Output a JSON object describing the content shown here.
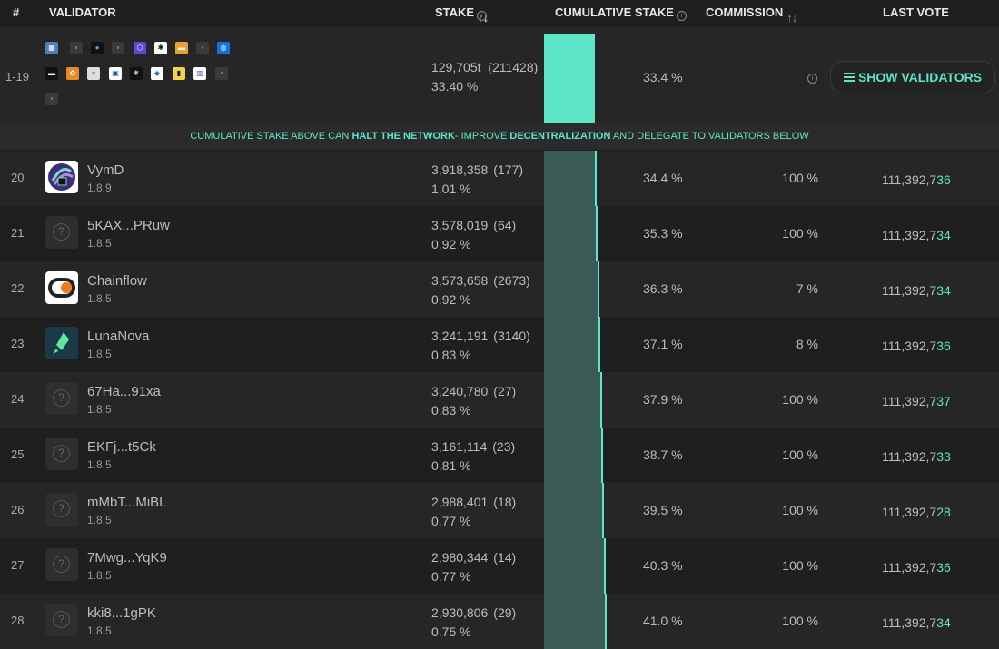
{
  "header": {
    "num": "#",
    "validator": "VALIDATOR",
    "stake": "STAKE",
    "cumulative": "CUMULATIVE STAKE",
    "commission": "COMMISSION",
    "last_vote": "LAST VOTE"
  },
  "top_group": {
    "range": "1-19",
    "stake": "129,705t",
    "count": "(211428)",
    "stake_pct": "33.40 %",
    "cumulative_pct": "33.4 %",
    "cumulative_fraction": 0.334,
    "show_button": "SHOW VALIDATORS"
  },
  "warning": {
    "part1": "CUMULATIVE STAKE ABOVE CAN ",
    "bold1": "HALT THE NETWORK",
    "part2": "- IMPROVE ",
    "bold2": "DECENTRALIZATION",
    "part3": " AND DELEGATE TO VALIDATORS BELOW"
  },
  "validators": [
    {
      "rank": "20",
      "name": "VymD",
      "version": "1.8.9",
      "stake": "3,918,358",
      "count": "(177)",
      "stake_pct": "1.01 %",
      "cum_pct": "34.4 %",
      "commission": "100 %",
      "vote_prefix": "111,392,7",
      "vote_suffix": "36",
      "avatar": "vymd-logo"
    },
    {
      "rank": "21",
      "name": "5KAX...PRuw",
      "version": "1.8.5",
      "stake": "3,578,019",
      "count": "(64)",
      "stake_pct": "0.92 %",
      "cum_pct": "35.3 %",
      "commission": "100 %",
      "vote_prefix": "111,392,7",
      "vote_suffix": "34",
      "avatar": "unknown"
    },
    {
      "rank": "22",
      "name": "Chainflow",
      "version": "1.8.5",
      "stake": "3,573,658",
      "count": "(2673)",
      "stake_pct": "0.92 %",
      "cum_pct": "36.3 %",
      "commission": "7 %",
      "vote_prefix": "111,392,7",
      "vote_suffix": "34",
      "avatar": "chainflow-logo"
    },
    {
      "rank": "23",
      "name": "LunaNova",
      "version": "1.8.5",
      "stake": "3,241,191",
      "count": "(3140)",
      "stake_pct": "0.83 %",
      "cum_pct": "37.1 %",
      "commission": "8 %",
      "vote_prefix": "111,392,7",
      "vote_suffix": "36",
      "avatar": "lunanova-logo"
    },
    {
      "rank": "24",
      "name": "67Ha...91xa",
      "version": "1.8.5",
      "stake": "3,240,780",
      "count": "(27)",
      "stake_pct": "0.83 %",
      "cum_pct": "37.9 %",
      "commission": "100 %",
      "vote_prefix": "111,392,7",
      "vote_suffix": "37",
      "avatar": "unknown"
    },
    {
      "rank": "25",
      "name": "EKFj...t5Ck",
      "version": "1.8.5",
      "stake": "3,161,114",
      "count": "(23)",
      "stake_pct": "0.81 %",
      "cum_pct": "38.7 %",
      "commission": "100 %",
      "vote_prefix": "111,392,7",
      "vote_suffix": "33",
      "avatar": "unknown"
    },
    {
      "rank": "26",
      "name": "mMbT...MiBL",
      "version": "1.8.5",
      "stake": "2,988,401",
      "count": "(18)",
      "stake_pct": "0.77 %",
      "cum_pct": "39.5 %",
      "commission": "100 %",
      "vote_prefix": "111,392,7",
      "vote_suffix": "28",
      "avatar": "unknown"
    },
    {
      "rank": "27",
      "name": "7Mwg...YqK9",
      "version": "1.8.5",
      "stake": "2,980,344",
      "count": "(14)",
      "stake_pct": "0.77 %",
      "cum_pct": "40.3 %",
      "commission": "100 %",
      "vote_prefix": "111,392,7",
      "vote_suffix": "36",
      "avatar": "unknown"
    },
    {
      "rank": "28",
      "name": "kki8...1gPK",
      "version": "1.8.5",
      "stake": "2,930,806",
      "count": "(29)",
      "stake_pct": "0.75 %",
      "cum_pct": "41.0 %",
      "commission": "100 %",
      "vote_prefix": "111,392,7",
      "vote_suffix": "34",
      "avatar": "unknown"
    }
  ],
  "colors": {
    "accent": "#5ee6c8",
    "bar_dim": "#3a5a55",
    "row_odd": "#262626",
    "row_even": "#1f1f1f"
  }
}
